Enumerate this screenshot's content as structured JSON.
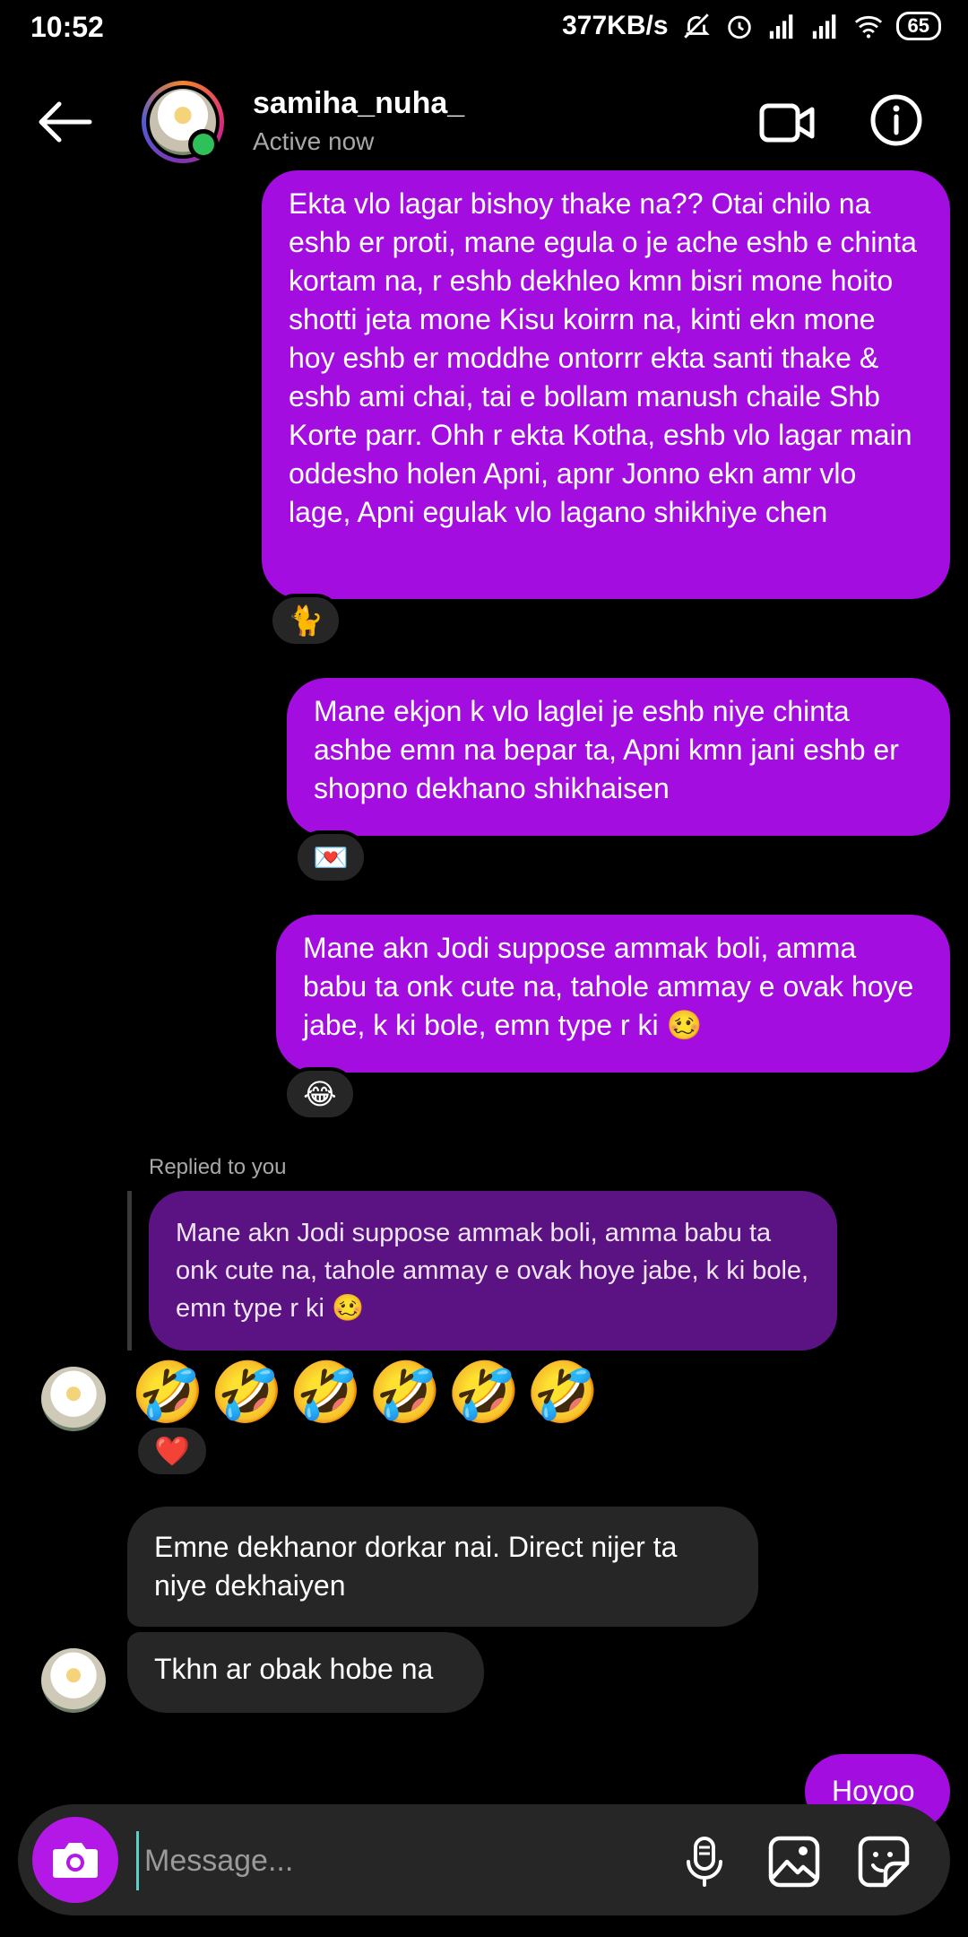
{
  "status_bar": {
    "time": "10:52",
    "network_speed": "377KB/s",
    "battery": "65"
  },
  "header": {
    "username": "samiha_nuha_",
    "status": "Active now"
  },
  "messages": {
    "m1": {
      "text": "Ekta vlo lagar bishoy thake na?? Otai chilo na eshb er proti, mane egula o je ache eshb e chinta kortam na, r eshb dekhleo kmn bisri mone hoito shotti jeta mone Kisu koirrn na, kinti ekn mone hoy eshb er moddhe ontorrr ekta santi thake & eshb ami chai, tai e bollam manush chaile Shb Korte parr. Ohh r ekta Kotha, eshb vlo lagar main oddesho holen Apni, apnr Jonno ekn amr vlo lage, Apni egulak vlo lagano shikhiye chen",
      "reaction": "🐈"
    },
    "m2": {
      "text": "Mane ekjon k vlo laglei je eshb niye chinta ashbe emn na bepar ta, Apni kmn jani eshb er shopno dekhano shikhaisen",
      "reaction": "💌"
    },
    "m3": {
      "text": "Mane akn Jodi suppose ammak boli, amma babu ta onk cute na, tahole ammay e ovak hoye jabe, k ki bole, emn type r ki 🥴",
      "reaction": "😂"
    },
    "reply": {
      "label": "Replied to you",
      "quote": "Mane akn Jodi suppose ammak boli, amma babu ta onk cute na, tahole ammay e ovak hoye jabe, k ki bole, emn type r ki 🥴",
      "emojis": "🤣🤣🤣🤣🤣🤣",
      "reaction": "❤️"
    },
    "r2": {
      "text": "Emne dekhanor dorkar nai. Direct nijer ta niye dekhaiyen"
    },
    "r3": {
      "text": "Tkhn ar obak hobe na"
    },
    "m4": {
      "text": "Hoyoo"
    }
  },
  "composer": {
    "placeholder": "Message..."
  },
  "colors": {
    "sent_bubble": "#a30ddf",
    "received_bubble": "#262626",
    "reply_quote": "#5b1283",
    "camera_button": "#b418e6",
    "online": "#2fc05a"
  },
  "icons": [
    "back-arrow-icon",
    "video-call-icon",
    "info-icon",
    "camera-icon",
    "microphone-icon",
    "gallery-icon",
    "sticker-icon"
  ]
}
